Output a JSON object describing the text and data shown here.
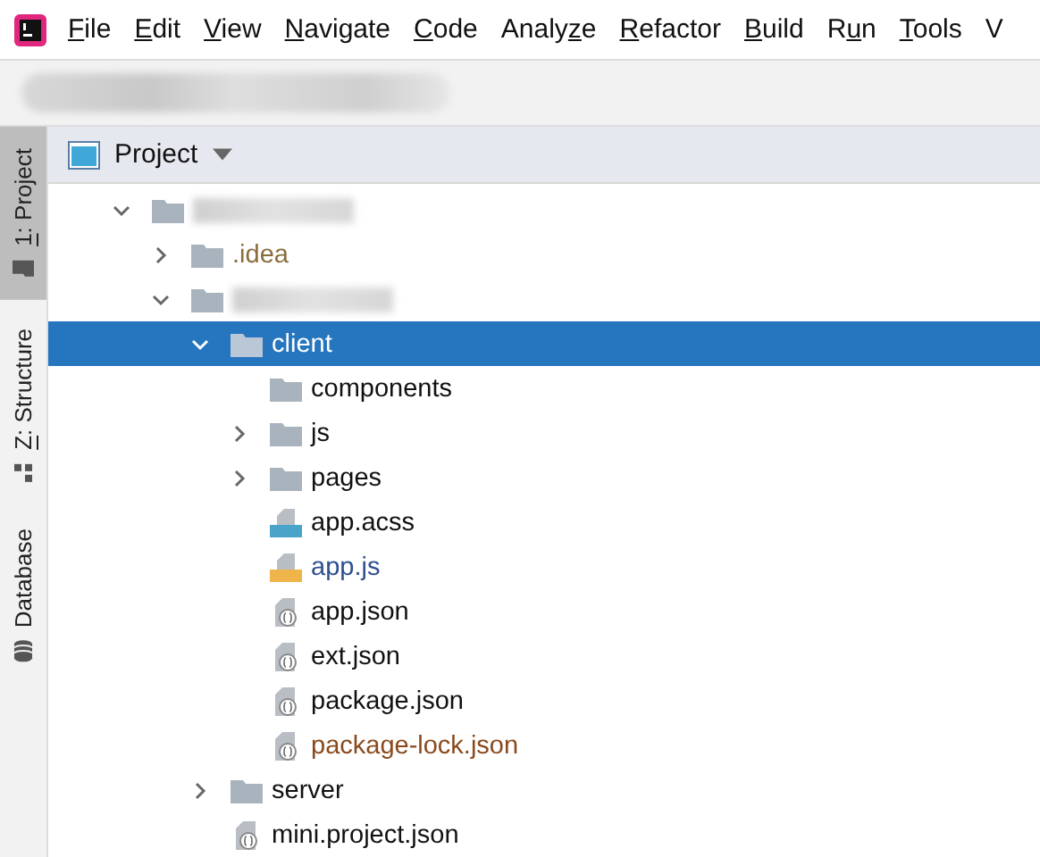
{
  "menu": [
    {
      "key": "F",
      "after": "ile"
    },
    {
      "key": "E",
      "after": "dit"
    },
    {
      "key": "V",
      "after": "iew"
    },
    {
      "key": "N",
      "after": "avigate"
    },
    {
      "key": "C",
      "after": "ode"
    },
    {
      "before": "Analy",
      "key": "z",
      "after": "e"
    },
    {
      "key": "R",
      "after": "efactor"
    },
    {
      "key": "B",
      "after": "uild"
    },
    {
      "before": "R",
      "key": "u",
      "after": "n"
    },
    {
      "key": "T",
      "after": "ools"
    },
    {
      "before": "V"
    }
  ],
  "side_tabs": [
    {
      "key": "1",
      "after": ": Project",
      "selected": true
    },
    {
      "key": "Z",
      "after": ": Structure",
      "selected": false
    },
    {
      "before": "Database",
      "selected": false
    }
  ],
  "panel": {
    "title": "Project"
  },
  "tree": [
    {
      "redacted": true,
      "kind": "folder",
      "expanded": true,
      "selected": false,
      "children": [
        {
          "label": ".idea",
          "kind": "folder",
          "expanded": false,
          "selected": false,
          "color": "#8a6d3b"
        },
        {
          "redacted": true,
          "kind": "folder",
          "expanded": true,
          "selected": false,
          "children": [
            {
              "label": "client",
              "kind": "folder",
              "expanded": true,
              "selected": true,
              "children": [
                {
                  "label": "components",
                  "kind": "folder",
                  "selected": false
                },
                {
                  "label": "js",
                  "kind": "folder",
                  "expanded": false,
                  "selected": false
                },
                {
                  "label": "pages",
                  "kind": "folder",
                  "expanded": false,
                  "selected": false
                },
                {
                  "label": "app.acss",
                  "kind": "css",
                  "selected": false
                },
                {
                  "label": "app.js",
                  "kind": "js",
                  "selected": false,
                  "color": "#2f4f8f"
                },
                {
                  "label": "app.json",
                  "kind": "json",
                  "selected": false
                },
                {
                  "label": "ext.json",
                  "kind": "json",
                  "selected": false
                },
                {
                  "label": "package.json",
                  "kind": "json",
                  "selected": false
                },
                {
                  "label": "package-lock.json",
                  "kind": "json",
                  "selected": false,
                  "color": "#8a4a1d"
                }
              ]
            },
            {
              "label": "server",
              "kind": "folder",
              "expanded": false,
              "selected": false
            },
            {
              "label": "mini.project.json",
              "kind": "json",
              "selected": false
            }
          ]
        }
      ]
    }
  ]
}
